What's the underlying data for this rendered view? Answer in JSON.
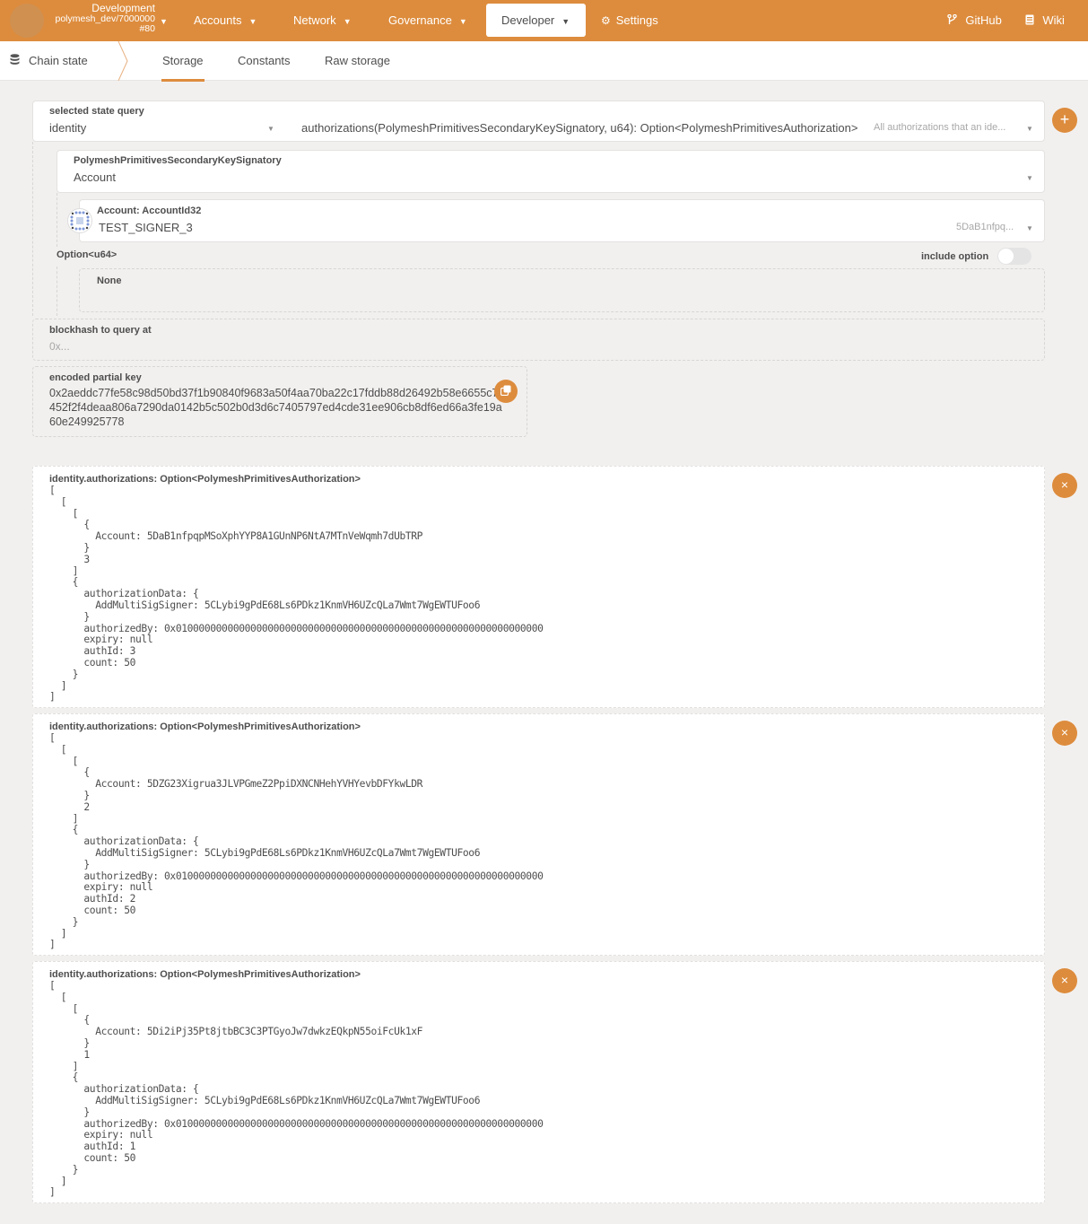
{
  "topnav": {
    "chain": {
      "name": "Development",
      "node": "polymesh_dev/7000000",
      "block": "#80"
    },
    "items": [
      {
        "label": "Accounts",
        "has_caret": true
      },
      {
        "label": "Network",
        "has_caret": true
      },
      {
        "label": "Governance",
        "has_caret": true
      },
      {
        "label": "Developer",
        "has_caret": true,
        "active": true
      },
      {
        "label": "Settings",
        "icon": "gears-icon"
      }
    ],
    "right": [
      {
        "label": "GitHub",
        "icon": "git-branch-icon"
      },
      {
        "label": "Wiki",
        "icon": "book-icon"
      }
    ],
    "accent": "#dd8c3d"
  },
  "subnav": {
    "section": "Chain state",
    "section_icon": "database-icon",
    "tabs": [
      {
        "label": "Storage",
        "active": true
      },
      {
        "label": "Constants"
      },
      {
        "label": "Raw storage"
      }
    ]
  },
  "query": {
    "label": "selected state query",
    "module": "identity",
    "method": "authorizations(PolymeshPrimitivesSecondaryKeySignatory, u64): Option<PolymeshPrimitivesAuthorization>",
    "method_doc": "All authorizations that an ide...",
    "add_button": "+",
    "param1": {
      "label": "PolymeshPrimitivesSecondaryKeySignatory",
      "value": "Account"
    },
    "account": {
      "label": "Account: AccountId32",
      "name": "TEST_SIGNER_3",
      "address_short": "5DaB1nfpq..."
    },
    "option": {
      "label": "Option<u64>",
      "include_label": "include option",
      "include_enabled": false,
      "value": "None"
    },
    "blockhash": {
      "label": "blockhash to query at",
      "placeholder": "0x..."
    },
    "encoded": {
      "label": "encoded partial key",
      "value": "0x2aeddc77fe58c98d50bd37f1b90840f9683a50f4aa70ba22c17fddb88d26492b58e6655c7e452f2f4deaa806a7290da0142b5c502b0d3d6c7405797ed4cde31ee906cb8df6ed66a3fe19a60e249925778"
    }
  },
  "results": [
    {
      "label": "identity.authorizations: Option<PolymeshPrimitivesAuthorization>",
      "account": "5DaB1nfpqpMSoXphYYP8A1GUnNP6NtA7MTnVeWqmh7dUbTRP",
      "index": "3",
      "signer": "5CLybi9gPdE68Ls6PDkz1KnmVH6UZcQLa7Wmt7WgEWTUFoo6",
      "authorizedBy": "0x0100000000000000000000000000000000000000000000000000000000000000",
      "expiry": "null",
      "authId": "3",
      "count": "50"
    },
    {
      "label": "identity.authorizations: Option<PolymeshPrimitivesAuthorization>",
      "account": "5DZG23Xigrua3JLVPGmeZ2PpiDXNCNHehYVHYevbDFYkwLDR",
      "index": "2",
      "signer": "5CLybi9gPdE68Ls6PDkz1KnmVH6UZcQLa7Wmt7WgEWTUFoo6",
      "authorizedBy": "0x0100000000000000000000000000000000000000000000000000000000000000",
      "expiry": "null",
      "authId": "2",
      "count": "50"
    },
    {
      "label": "identity.authorizations: Option<PolymeshPrimitivesAuthorization>",
      "account": "5Di2iPj35Pt8jtbBC3C3PTGyoJw7dwkzEQkpN55oiFcUk1xF",
      "index": "1",
      "signer": "5CLybi9gPdE68Ls6PDkz1KnmVH6UZcQLa7Wmt7WgEWTUFoo6",
      "authorizedBy": "0x0100000000000000000000000000000000000000000000000000000000000000",
      "expiry": "null",
      "authId": "1",
      "count": "50"
    }
  ],
  "remove_button": "×"
}
